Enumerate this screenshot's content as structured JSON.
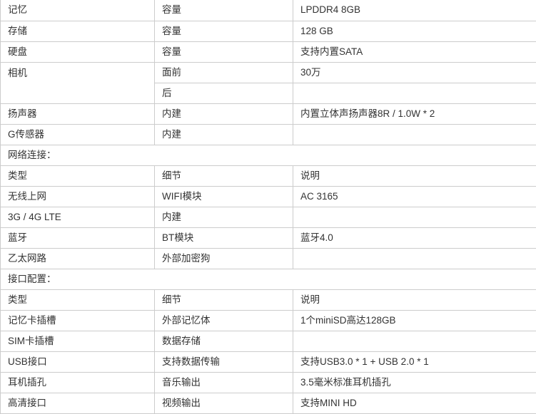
{
  "table": {
    "columns": 3,
    "border_color": "#cccccc",
    "text_color": "#333333",
    "background": "#ffffff",
    "rows": [
      {
        "type": "data",
        "cells": [
          "记忆",
          "容量",
          "LPDDR4 8GB"
        ]
      },
      {
        "type": "data",
        "cells": [
          "存储",
          "容量",
          "128 GB"
        ]
      },
      {
        "type": "data",
        "cells": [
          "硬盘",
          "容量",
          "支持内置SATA"
        ]
      },
      {
        "type": "data",
        "rowspan_first": 2,
        "cells": [
          "相机",
          "面前",
          "30万"
        ]
      },
      {
        "type": "data",
        "continued": true,
        "cells": [
          "",
          "后",
          ""
        ]
      },
      {
        "type": "data",
        "cells": [
          "扬声器",
          "内建",
          "内置立体声扬声器8R / 1.0W * 2"
        ]
      },
      {
        "type": "data",
        "cells": [
          "G传感器",
          "内建",
          ""
        ]
      },
      {
        "type": "section",
        "cells": [
          "网络连接："
        ]
      },
      {
        "type": "header",
        "cells": [
          "类型",
          "细节",
          "说明"
        ]
      },
      {
        "type": "data",
        "cells": [
          "无线上网",
          "WIFI模块",
          "AC 3165"
        ]
      },
      {
        "type": "data",
        "cells": [
          "3G / 4G LTE",
          "内建",
          ""
        ]
      },
      {
        "type": "data",
        "cells": [
          "蓝牙",
          "BT模块",
          "蓝牙4.0"
        ]
      },
      {
        "type": "data",
        "cells": [
          "乙太网路",
          "外部加密狗",
          ""
        ]
      },
      {
        "type": "section",
        "cells": [
          "接口配置："
        ]
      },
      {
        "type": "header",
        "cells": [
          "类型",
          "细节",
          "说明"
        ]
      },
      {
        "type": "data",
        "cells": [
          "记忆卡插槽",
          "外部记忆体",
          "1个miniSD高达128GB"
        ]
      },
      {
        "type": "data",
        "cells": [
          "SIM卡插槽",
          "数据存储",
          ""
        ]
      },
      {
        "type": "data",
        "cells": [
          "USB接口",
          "支持数据传输",
          "支持USB3.0 * 1 + USB 2.0 * 1"
        ]
      },
      {
        "type": "data",
        "cells": [
          "耳机插孔",
          "音乐输出",
          "3.5毫米标准耳机插孔"
        ]
      },
      {
        "type": "data",
        "cells": [
          "高清接口",
          "视频输出",
          "支持MINI HD"
        ]
      }
    ]
  }
}
